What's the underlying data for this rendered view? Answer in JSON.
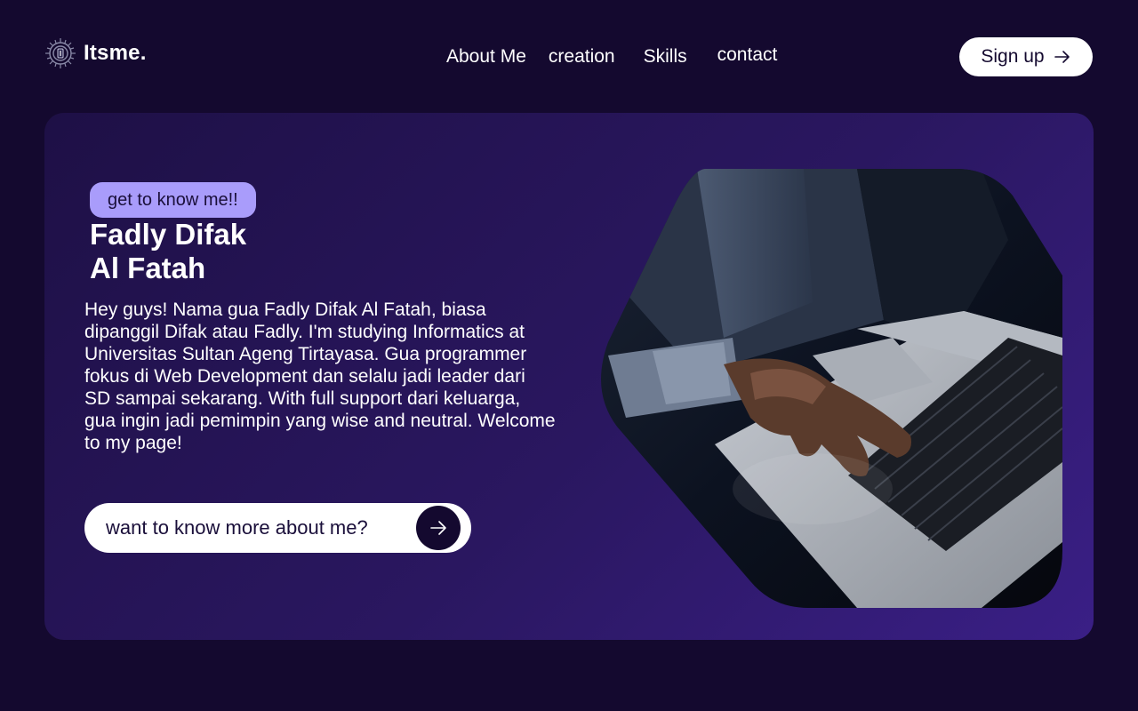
{
  "brand": {
    "name": "Itsme.",
    "logo_icon": "circuit-chip-icon"
  },
  "nav": {
    "items": [
      {
        "label": "About Me"
      },
      {
        "label": "creation"
      },
      {
        "label": "Skills"
      },
      {
        "label": "contact"
      }
    ],
    "signup_label": "Sign up",
    "signup_icon": "arrow-right-icon"
  },
  "hero": {
    "badge": "get to know me!!",
    "name_line1": "Fadly Difak",
    "name_line2": "Al Fatah",
    "bio": "Hey guys! Nama gua Fadly Difak Al Fatah, biasa dipanggil Difak atau Fadly. I'm studying Informatics at Universitas Sultan Ageng Tirtayasa. Gua programmer fokus di Web Development dan selalu jadi leader dari SD sampai sekarang. With full support dari keluarga, gua ingin jadi pemimpin yang wise and neutral. Welcome to my page!",
    "cta_label": "want to know more about me?",
    "cta_icon": "arrow-right-icon",
    "image_icon": "laptop-typing-photo"
  },
  "colors": {
    "background": "#14092f",
    "card_gradient_start": "#1e1046",
    "card_gradient_end": "#3a1f86",
    "badge": "#a99cfb",
    "button_bg": "#ffffff"
  }
}
